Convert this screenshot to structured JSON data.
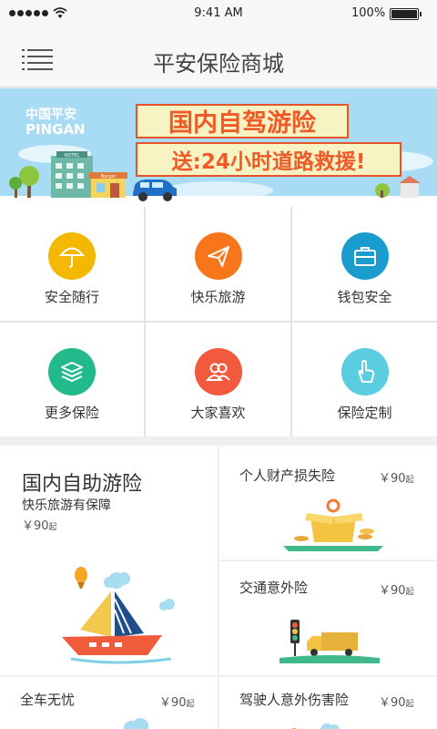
{
  "status_bar": {
    "time": "9:41 AM",
    "battery": "100%"
  },
  "nav": {
    "title": "平安保险商城"
  },
  "banner": {
    "logo_cn": "中国平安",
    "logo_en": "PINGAN",
    "headline": "国内自驾游险",
    "subline": "送:24小时道路救援!",
    "hotel_sign": "HOTEL",
    "burger_sign": "Burger"
  },
  "categories": [
    {
      "label": "安全随行",
      "icon": "umbrella-icon",
      "color": "#f5b800"
    },
    {
      "label": "快乐旅游",
      "icon": "paper-plane-icon",
      "color": "#f8761b"
    },
    {
      "label": "钱包安全",
      "icon": "briefcase-icon",
      "color": "#1b9ccf"
    },
    {
      "label": "更多保险",
      "icon": "layers-icon",
      "color": "#22b98b"
    },
    {
      "label": "大家喜欢",
      "icon": "users-icon",
      "color": "#f15a3c"
    },
    {
      "label": "保险定制",
      "icon": "hand-pointer-icon",
      "color": "#5bcde0"
    }
  ],
  "featured": {
    "title": "国内自助游险",
    "subtitle": "快乐旅游有保障",
    "price": "￥90",
    "price_unit": "起"
  },
  "products": [
    {
      "name": "个人财产损失险",
      "price": "￥90",
      "price_unit": "起"
    },
    {
      "name": "交通意外险",
      "price": "￥90",
      "price_unit": "起"
    },
    {
      "name": "全车无忧",
      "price": "￥90",
      "price_unit": "起"
    },
    {
      "name": "驾驶人意外伤害险",
      "price": "￥90",
      "price_unit": "起"
    }
  ]
}
